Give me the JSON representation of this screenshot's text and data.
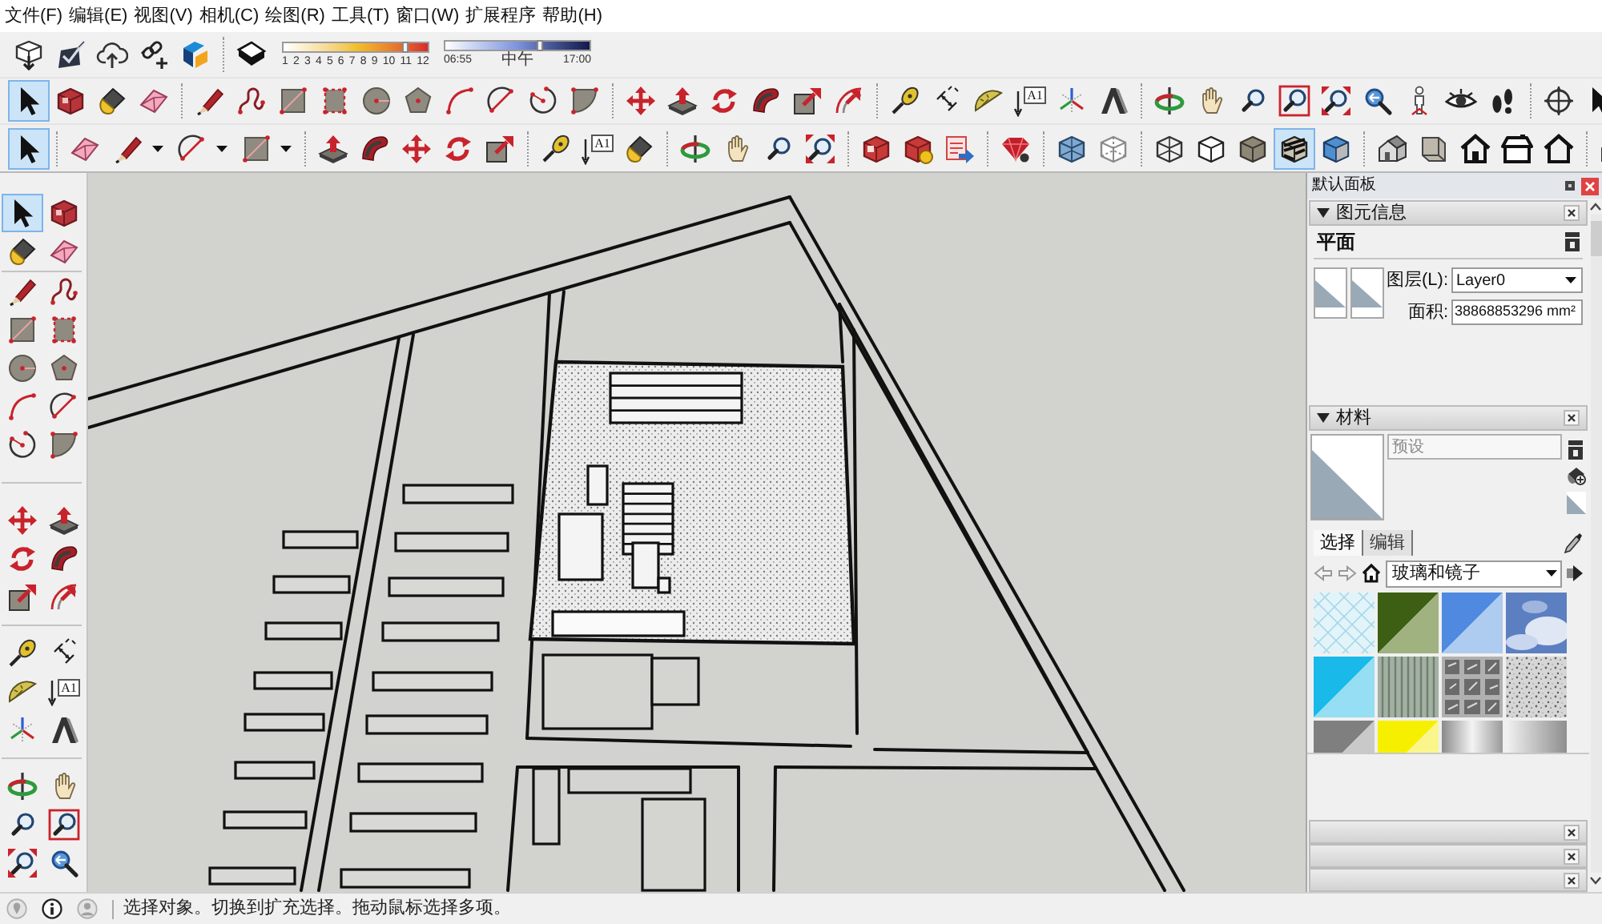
{
  "menu_bar": {
    "items": [
      "文件(F)",
      "编辑(E)",
      "视图(V)",
      "相机(C)",
      "绘图(R)",
      "工具(T)",
      "窗口(W)",
      "扩展程序",
      "帮助(H)"
    ]
  },
  "toolbar_row_1": {
    "shadow_settings": {
      "month_slider": {
        "level": 0.84,
        "labels": [
          "1",
          "2",
          "3",
          "4",
          "5",
          "6",
          "7",
          "8",
          "9",
          "10",
          "11",
          "12"
        ]
      },
      "time_slider": {
        "level": 0.66,
        "labels": [
          "06:55",
          "中午",
          "17:00"
        ]
      }
    }
  },
  "toolbar_row_2": {
    "groups": [
      [
        {
          "selected": true
        },
        {
          "selected": false
        },
        {
          "selected": false
        },
        {
          "selected": false
        }
      ],
      [
        {
          "selected": false
        },
        {
          "selected": false
        },
        {
          "selected": false
        },
        {
          "selected": false
        },
        {
          "selected": false
        },
        {
          "selected": false
        },
        {
          "selected": false
        },
        {
          "selected": false
        },
        {
          "selected": false
        },
        {
          "selected": false
        }
      ],
      [
        {
          "selected": false
        },
        {
          "selected": false
        },
        {
          "selected": false
        },
        {
          "selected": false
        },
        {
          "selected": false
        },
        {
          "selected": false
        }
      ],
      [
        {
          "selected": false
        },
        {
          "selected": false
        },
        {
          "selected": false
        },
        {
          "selected": false,
          "label": "A1"
        },
        {
          "selected": false
        },
        {
          "selected": false
        }
      ],
      [
        {
          "selected": false
        },
        {
          "selected": false
        },
        {
          "selected": false
        },
        {
          "selected": false
        },
        {
          "selected": false
        },
        {
          "selected": false
        },
        {
          "selected": false
        },
        {
          "selected": false
        },
        {
          "selected": false
        }
      ],
      [
        {
          "selected": false
        },
        {
          "selected": false
        }
      ]
    ]
  },
  "toolbar_row_3": {
    "groups": [
      [
        {
          "selected": true
        }
      ],
      [
        {
          "kind": "button",
          "selected": false
        },
        {
          "kind": "split",
          "selected": false
        },
        {
          "kind": "split",
          "selected": false
        },
        {
          "kind": "split",
          "selected": false
        }
      ],
      [
        {
          "selected": false
        },
        {
          "selected": false
        },
        {
          "selected": false
        },
        {
          "selected": false
        },
        {
          "selected": false
        }
      ],
      [
        {
          "selected": false
        },
        {
          "selected": false,
          "label": "A1"
        },
        {
          "selected": false
        }
      ],
      [
        {
          "selected": false
        },
        {
          "selected": false
        },
        {
          "selected": false
        },
        {
          "selected": false
        }
      ],
      [
        {
          "selected": false
        },
        {
          "selected": false
        },
        {
          "selected": false
        }
      ],
      [
        {
          "selected": false
        }
      ],
      [
        {
          "selected": false
        },
        {
          "selected": false
        }
      ],
      [
        {
          "selected": false
        },
        {
          "selected": false
        },
        {
          "selected": false
        },
        {
          "selected": true
        },
        {
          "selected": false
        }
      ],
      [
        {
          "selected": false
        },
        {
          "selected": false
        },
        {
          "selected": false
        },
        {
          "selected": false
        },
        {
          "selected": false
        }
      ],
      [
        {
          "selected": false
        }
      ]
    ]
  },
  "left_toolbar": {
    "groups": [
      [
        {
          "selected": true
        },
        {
          "selected": false
        },
        {
          "selected": false
        },
        {
          "selected": false
        }
      ],
      [
        {
          "selected": false
        },
        {
          "selected": false
        },
        {
          "selected": false
        },
        {
          "selected": false
        },
        {
          "selected": false
        },
        {
          "selected": false
        },
        {
          "selected": false
        },
        {
          "selected": false
        },
        {
          "selected": false
        },
        {
          "selected": false
        }
      ],
      [
        {
          "selected": false
        },
        {
          "selected": false
        },
        {
          "selected": false
        },
        {
          "selected": false
        },
        {
          "selected": false
        },
        {
          "selected": false
        }
      ],
      [
        {
          "selected": false
        },
        {
          "selected": false
        },
        {
          "selected": false
        },
        {
          "selected": false,
          "label": "A1"
        },
        {
          "selected": false
        },
        {
          "selected": false
        }
      ],
      [
        {
          "selected": false
        },
        {
          "selected": false
        },
        {
          "selected": false
        },
        {
          "selected": false
        },
        {
          "selected": false
        },
        {
          "selected": false
        }
      ]
    ]
  },
  "default_tray": {
    "title": "默认面板",
    "entity_info": {
      "title": "图元信息",
      "expanded": true,
      "entity_type": "平面",
      "layer_label": "图层(L):",
      "layer_value": "Layer0",
      "area_label": "面积:",
      "area_value": "38868853296 mm²"
    },
    "materials": {
      "title": "材料",
      "expanded": true,
      "name_placeholder": "预设",
      "tabs": [
        {
          "label": "选择",
          "selected": true
        },
        {
          "label": "编辑",
          "selected": false
        }
      ],
      "library": "玻璃和镜子"
    }
  },
  "status_bar": {
    "message": "选择对象。切换到扩充选择。拖动鼠标选择多项。"
  }
}
